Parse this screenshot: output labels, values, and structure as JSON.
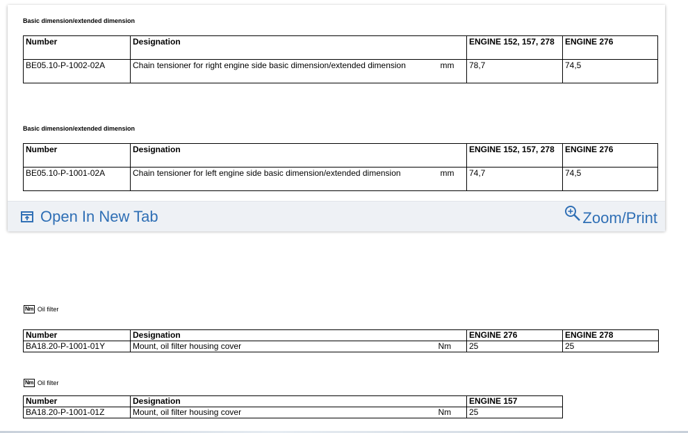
{
  "section1": {
    "caption": "Basic dimension/extended dimension",
    "headers": [
      "Number",
      "Designation",
      "",
      "ENGINE 152, 157, 278",
      "ENGINE 276"
    ],
    "row": [
      "BE05.10-P-1002-02A",
      "Chain tensioner for right engine side basic dimension/extended dimension",
      "mm",
      "78,7",
      "74,5"
    ]
  },
  "section2": {
    "caption": "Basic dimension/extended dimension",
    "headers": [
      "Number",
      "Designation",
      "",
      "ENGINE 152, 157, 278",
      "ENGINE 276"
    ],
    "row": [
      "BE05.10-P-1001-02A",
      "Chain tensioner for left engine side basic dimension/extended dimension",
      "mm",
      "74,7",
      "74,5"
    ]
  },
  "footer": {
    "open_tab": "Open In New Tab",
    "zoom_print": "Zoom/Print"
  },
  "section3": {
    "icon": "Nm",
    "caption": "Oil filter",
    "headers": [
      "Number",
      "Designation",
      "",
      "ENGINE 276",
      "ENGINE 278"
    ],
    "row": [
      "BA18.20-P-1001-01Y",
      "Mount, oil filter housing cover",
      "Nm",
      "25",
      "25"
    ]
  },
  "section4": {
    "icon": "Nm",
    "caption": "Oil filter",
    "headers": [
      "Number",
      "Designation",
      "",
      "ENGINE 157"
    ],
    "row": [
      "BA18.20-P-1001-01Z",
      "Mount, oil filter housing cover",
      "Nm",
      "25"
    ]
  }
}
